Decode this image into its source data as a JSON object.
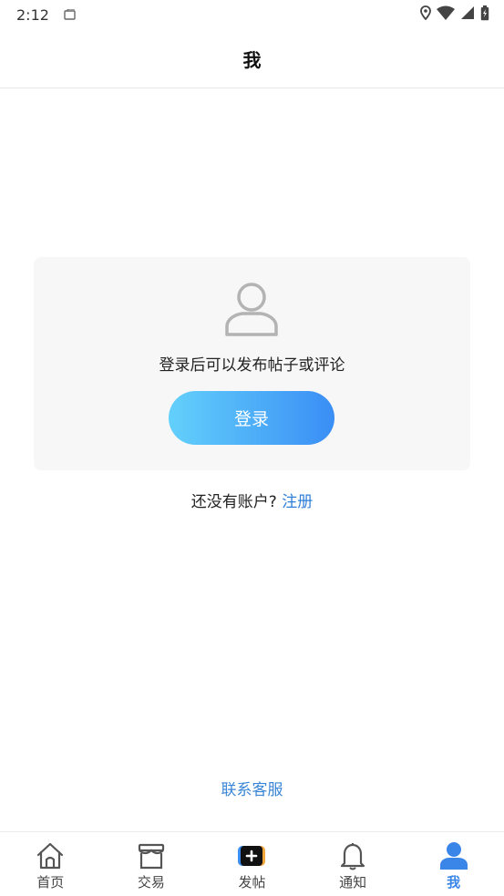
{
  "status_bar": {
    "time": "2:12"
  },
  "header": {
    "title": "我"
  },
  "login_card": {
    "message": "登录后可以发布帖子或评论",
    "login_label": "登录"
  },
  "register": {
    "prompt": "还没有账户?",
    "link_label": "注册"
  },
  "contact": {
    "label": "联系客服"
  },
  "bottom_nav": {
    "items": [
      {
        "label": "首页",
        "icon": "home-icon"
      },
      {
        "label": "交易",
        "icon": "store-icon"
      },
      {
        "label": "发帖",
        "icon": "add-post-icon"
      },
      {
        "label": "通知",
        "icon": "bell-icon"
      },
      {
        "label": "我",
        "icon": "user-icon",
        "active": true
      }
    ]
  },
  "colors": {
    "accent": "#3a86e8",
    "gradient_start": "#63d0fb",
    "gradient_end": "#3a8ef5"
  }
}
